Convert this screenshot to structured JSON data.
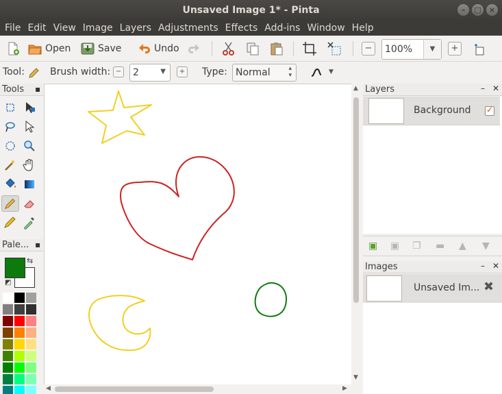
{
  "window": {
    "title": "Unsaved Image 1* - Pinta"
  },
  "menu": [
    "File",
    "Edit",
    "View",
    "Image",
    "Layers",
    "Adjustments",
    "Effects",
    "Add-ins",
    "Window",
    "Help"
  ],
  "toolbar": {
    "open_label": "Open",
    "save_label": "Save",
    "undo_label": "Undo",
    "zoom_value": "100%"
  },
  "tool_options": {
    "tool_label": "Tool:",
    "brush_width_label": "Brush width:",
    "brush_width_value": "2",
    "type_label": "Type:",
    "type_value": "Normal"
  },
  "panels": {
    "tools_title": "Tools",
    "palette_title": "Pale...",
    "layers_title": "Layers",
    "images_title": "Images"
  },
  "layers": [
    {
      "name": "Background",
      "visible": true
    }
  ],
  "images": [
    {
      "name": "Unsaved Im..."
    }
  ],
  "palette": {
    "primary_color": "#0c7a0c",
    "secondary_color": "#ffffff",
    "colors": [
      [
        "#ffffff",
        "#000000",
        "#a0a0a0"
      ],
      [
        "#808080",
        "#404040",
        "#303030"
      ],
      [
        "#800000",
        "#ff0000",
        "#ff8080"
      ],
      [
        "#804000",
        "#ff8000",
        "#ffb080"
      ],
      [
        "#808000",
        "#ffd800",
        "#ffe080"
      ],
      [
        "#408000",
        "#b0ff00",
        "#d0ff80"
      ],
      [
        "#008000",
        "#00ff00",
        "#80ff80"
      ],
      [
        "#008040",
        "#00ff80",
        "#80ffb0"
      ],
      [
        "#008080",
        "#00ffff",
        "#80ffff"
      ]
    ]
  },
  "drawing": {
    "star_color": "#f0d020",
    "heart_color": "#d02020",
    "circle_color": "#107a10",
    "moon_color": "#f0d020"
  }
}
